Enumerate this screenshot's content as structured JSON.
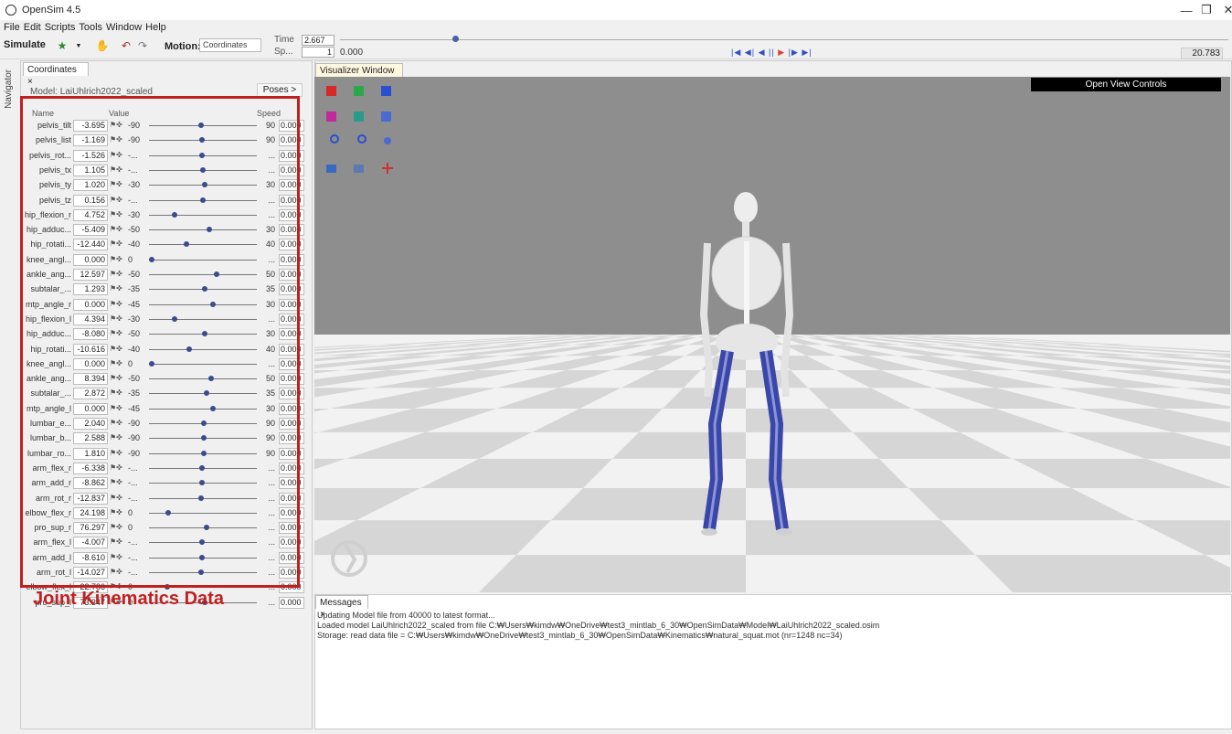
{
  "window": {
    "title": "OpenSim 4.5"
  },
  "menu": [
    "File",
    "Edit",
    "Scripts",
    "Tools",
    "Window",
    "Help"
  ],
  "toolbar": {
    "simulate_label": "Simulate",
    "motion_label": "Motion:",
    "motion_value": "Coordinates",
    "time_label": "Time",
    "time_value": "2.667",
    "speed_label": "Sp...",
    "speed_value": "1",
    "time_start": "0.000",
    "time_end": "20.783",
    "time_fraction": 0.128
  },
  "navigator_label": "Navigator",
  "coords_panel": {
    "tab": "Coordinates",
    "model_label": "Model:  LaiUhlrich2022_scaled",
    "poses_button": "Poses >",
    "col_name": "Name",
    "col_value": "Value",
    "col_speed": "Speed",
    "rows": [
      {
        "name": "pelvis_tilt",
        "value": "-3.695",
        "min": "-90",
        "max": "90",
        "speed": "0.000",
        "pos": 0.48
      },
      {
        "name": "pelvis_list",
        "value": "-1.169",
        "min": "-90",
        "max": "90",
        "speed": "0.000",
        "pos": 0.49
      },
      {
        "name": "pelvis_rot...",
        "value": "-1.526",
        "min": "-...",
        "max": "...",
        "speed": "0.000",
        "pos": 0.49
      },
      {
        "name": "pelvis_tx",
        "value": "1.105",
        "min": "-...",
        "max": "...",
        "speed": "0.000",
        "pos": 0.5
      },
      {
        "name": "pelvis_ty",
        "value": "1.020",
        "min": "-30",
        "max": "30",
        "speed": "0.000",
        "pos": 0.52
      },
      {
        "name": "pelvis_tz",
        "value": "0.156",
        "min": "-...",
        "max": "...",
        "speed": "0.000",
        "pos": 0.5
      },
      {
        "name": "hip_flexion_r",
        "value": "4.752",
        "min": "-30",
        "max": "...",
        "speed": "0.000",
        "pos": 0.22
      },
      {
        "name": "hip_adduc...",
        "value": "-5.409",
        "min": "-50",
        "max": "30",
        "speed": "0.000",
        "pos": 0.56
      },
      {
        "name": "hip_rotati...",
        "value": "-12.440",
        "min": "-40",
        "max": "40",
        "speed": "0.000",
        "pos": 0.34
      },
      {
        "name": "knee_angl...",
        "value": "0.000",
        "min": "0",
        "max": "...",
        "speed": "0.000",
        "pos": 0.0
      },
      {
        "name": "ankle_ang...",
        "value": "12.597",
        "min": "-50",
        "max": "50",
        "speed": "0.000",
        "pos": 0.63
      },
      {
        "name": "subtalar_...",
        "value": "1.293",
        "min": "-35",
        "max": "35",
        "speed": "0.000",
        "pos": 0.52
      },
      {
        "name": "mtp_angle_r",
        "value": "0.000",
        "min": "-45",
        "max": "30",
        "speed": "0.000",
        "pos": 0.6
      },
      {
        "name": "hip_flexion_l",
        "value": "4.394",
        "min": "-30",
        "max": "...",
        "speed": "0.000",
        "pos": 0.22
      },
      {
        "name": "hip_adduc...",
        "value": "-8.080",
        "min": "-50",
        "max": "30",
        "speed": "0.000",
        "pos": 0.52
      },
      {
        "name": "hip_rotati...",
        "value": "-10.616",
        "min": "-40",
        "max": "40",
        "speed": "0.000",
        "pos": 0.37
      },
      {
        "name": "knee_angl...",
        "value": "0.000",
        "min": "0",
        "max": "...",
        "speed": "0.000",
        "pos": 0.0
      },
      {
        "name": "ankle_ang...",
        "value": "8.394",
        "min": "-50",
        "max": "50",
        "speed": "0.000",
        "pos": 0.58
      },
      {
        "name": "subtalar_...",
        "value": "2.872",
        "min": "-35",
        "max": "35",
        "speed": "0.000",
        "pos": 0.54
      },
      {
        "name": "mtp_angle_l",
        "value": "0.000",
        "min": "-45",
        "max": "30",
        "speed": "0.000",
        "pos": 0.6
      },
      {
        "name": "lumbar_e...",
        "value": "2.040",
        "min": "-90",
        "max": "90",
        "speed": "0.000",
        "pos": 0.51
      },
      {
        "name": "lumbar_b...",
        "value": "2.588",
        "min": "-90",
        "max": "90",
        "speed": "0.000",
        "pos": 0.51
      },
      {
        "name": "lumbar_ro...",
        "value": "1.810",
        "min": "-90",
        "max": "90",
        "speed": "0.000",
        "pos": 0.51
      },
      {
        "name": "arm_flex_r",
        "value": "-6.338",
        "min": "-...",
        "max": "...",
        "speed": "0.000",
        "pos": 0.49
      },
      {
        "name": "arm_add_r",
        "value": "-8.862",
        "min": "-...",
        "max": "...",
        "speed": "0.000",
        "pos": 0.49
      },
      {
        "name": "arm_rot_r",
        "value": "-12.837",
        "min": "-...",
        "max": "...",
        "speed": "0.000",
        "pos": 0.48
      },
      {
        "name": "elbow_flex_r",
        "value": "24.198",
        "min": "0",
        "max": "...",
        "speed": "0.000",
        "pos": 0.16
      },
      {
        "name": "pro_sup_r",
        "value": "76.297",
        "min": "0",
        "max": "...",
        "speed": "0.000",
        "pos": 0.54
      },
      {
        "name": "arm_flex_l",
        "value": "-4.007",
        "min": "-...",
        "max": "...",
        "speed": "0.000",
        "pos": 0.49
      },
      {
        "name": "arm_add_l",
        "value": "-8.610",
        "min": "-...",
        "max": "...",
        "speed": "0.000",
        "pos": 0.49
      },
      {
        "name": "arm_rot_l",
        "value": "-14.027",
        "min": "-...",
        "max": "...",
        "speed": "0.000",
        "pos": 0.48
      },
      {
        "name": "elbow_flex_l",
        "value": "22.786",
        "min": "0",
        "max": "...",
        "speed": "0.000",
        "pos": 0.15
      },
      {
        "name": "pro_sup_l",
        "value": "73.347",
        "min": "0",
        "max": "...",
        "speed": "0.000",
        "pos": 0.52
      }
    ]
  },
  "annotation": "Joint Kinematics Data",
  "visualizer": {
    "tab": "Visualizer Window",
    "open_view_controls": "Open View Controls"
  },
  "messages": {
    "tab": "Messages",
    "lines": [
      "Updating Model file from 40000 to latest format...",
      "Loaded model LaiUhlrich2022_scaled from file C:₩Users₩kimdw₩OneDrive₩test3_mintlab_6_30₩OpenSimData₩Model₩LaiUhlrich2022_scaled.osim",
      "Storage: read data file = C:₩Users₩kimdw₩OneDrive₩test3_mintlab_6_30₩OpenSimData₩Kinematics₩natural_squat.mot (nr=1248 nc=34)"
    ]
  },
  "colors": {
    "accent": "#c0201f",
    "floor_light": "#f2f2f2",
    "floor_dark": "#d6d6d6",
    "muscle": "#3b47a8"
  }
}
